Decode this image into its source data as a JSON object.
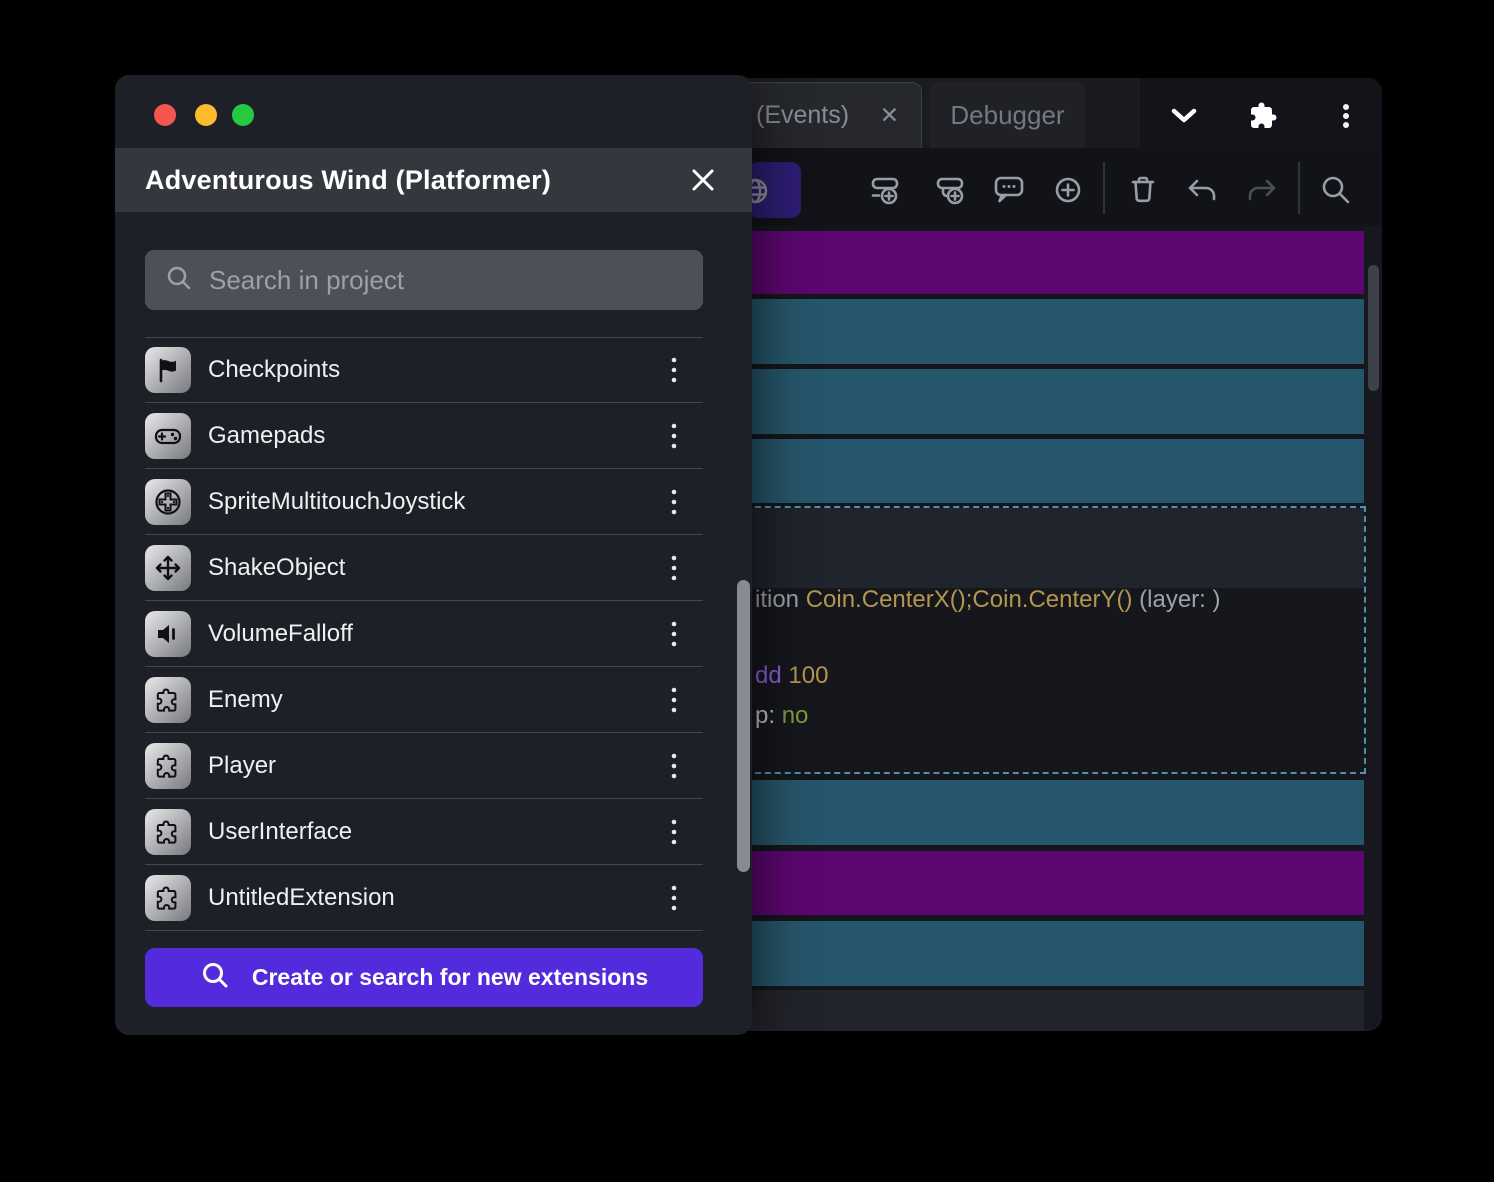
{
  "theme": {
    "window_bg": "#17181d",
    "tabbar_bg": "#191b20",
    "tabbar_right_bg": "#131419",
    "tab_active_bg": "#26282e",
    "tab_active_border": "#3c3f46",
    "tab_inactive_bg": "#1f2127",
    "tab_text": "#8a8d94",
    "tab_inactive_text": "#75787e",
    "toolbar_bg": "#121318",
    "toolbar_icon": "#9a9da4",
    "toolbar_icon_disabled": "#4b4e55",
    "toolbar_divider": "#31343b",
    "toolbar_button_bg": "#2e1d73",
    "toolbar_button_icon": "#8f9297",
    "events_bg": "#14161b",
    "events_footer_bg": "#22242b",
    "row_purple": "#5c0670",
    "row_teal": "#26566b",
    "selection_border": "#4f92ae",
    "selection_top_bg": "#20242c",
    "selection_bottom_bg": "#15171d",
    "scrollbar_events": "#3d4149",
    "scrollbar_panel": "#888b91",
    "panel_bg": "#1e2028",
    "panel_header_bg": "#34373e",
    "search_bg": "#4d5057",
    "placeholder_color": "#9da0a7",
    "divider_color": "#454851",
    "item_label_color": "#eef0f2",
    "tile_grad_start": "#e9e9ea",
    "tile_grad_end": "#77797e",
    "cta_bg": "#532bdd",
    "traffic_red": "#f2564f",
    "traffic_yellow": "#fdbb2d",
    "traffic_green": "#27c93f"
  },
  "project_manager": {
    "title": "Adventurous Wind (Platformer)",
    "search": {
      "placeholder": "Search in project"
    },
    "items": [
      {
        "label": "Checkpoints",
        "icon": "flag-icon"
      },
      {
        "label": "Gamepads",
        "icon": "gamepad-icon"
      },
      {
        "label": "SpriteMultitouchJoystick",
        "icon": "joystick-icon"
      },
      {
        "label": "ShakeObject",
        "icon": "move-arrows-icon"
      },
      {
        "label": "VolumeFalloff",
        "icon": "speaker-icon"
      },
      {
        "label": "Enemy",
        "icon": "puzzle-icon"
      },
      {
        "label": "Player",
        "icon": "puzzle-icon"
      },
      {
        "label": "UserInterface",
        "icon": "puzzle-icon"
      },
      {
        "label": "UntitledExtension",
        "icon": "puzzle-icon"
      }
    ],
    "cta": {
      "label": "Create or search for new extensions"
    }
  },
  "editor": {
    "tabs": {
      "events": {
        "label": "(Events)",
        "close": "✕"
      },
      "debugger": {
        "label": "Debugger"
      }
    },
    "toolbar_icons": [
      "globe",
      "add-event",
      "add-sub-event",
      "add-comment",
      "add-circle",
      "trash",
      "undo",
      "redo",
      "search"
    ],
    "events": {
      "rows": [
        {
          "kind": "purple"
        },
        {
          "kind": "teal"
        },
        {
          "kind": "teal"
        },
        {
          "kind": "teal"
        },
        {
          "kind": "selected"
        },
        {
          "kind": "teal"
        },
        {
          "kind": "purple"
        },
        {
          "kind": "teal"
        }
      ],
      "selected": {
        "condition": [
          {
            "text": "ition ",
            "color": "#9ea1a8"
          },
          {
            "text": "Coin.CenterX();Coin.CenterY()",
            "color": "#b5964f"
          },
          {
            "text": " (layer: )",
            "color": "#9ea1a8"
          }
        ],
        "action1": [
          {
            "text": "dd ",
            "color": "#8a5fd6"
          },
          {
            "text": "100",
            "color": "#b5964f"
          }
        ],
        "action2": [
          {
            "text": "p: ",
            "color": "#c0c3c8"
          },
          {
            "text": "no",
            "color": "#7d9c41"
          }
        ]
      }
    }
  }
}
